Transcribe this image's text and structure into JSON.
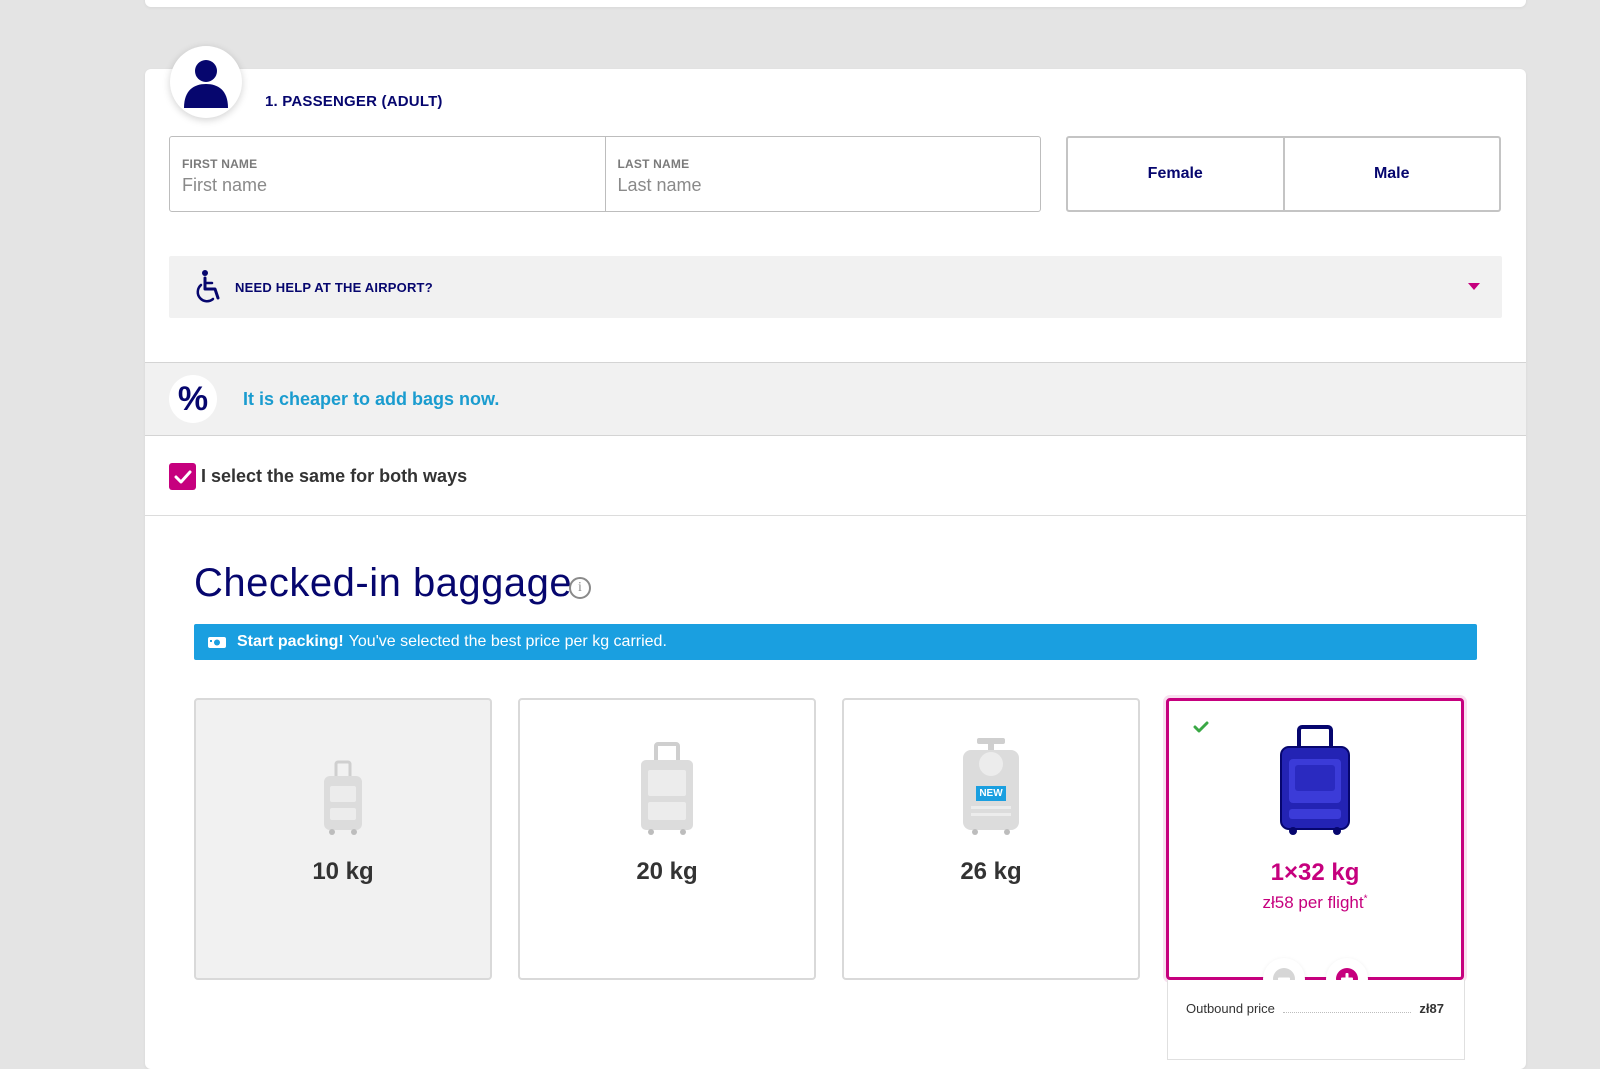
{
  "passenger": {
    "title": "1. PASSENGER (ADULT)",
    "first_name": {
      "label": "FIRST NAME",
      "placeholder": "First name",
      "value": ""
    },
    "last_name": {
      "label": "LAST NAME",
      "placeholder": "Last name",
      "value": ""
    },
    "gender_options": {
      "female": "Female",
      "male": "Male"
    },
    "help": {
      "label": "NEED HELP AT THE AIRPORT?"
    }
  },
  "promo": {
    "icon": "percent-icon",
    "symbol": "%",
    "text": "It is cheaper to add bags now."
  },
  "same_both_ways": {
    "label": "I select the same for both ways",
    "checked": true
  },
  "baggage": {
    "title": "Checked-in baggage",
    "info_symbol": "i",
    "banner": {
      "strong": "Start packing!",
      "text": "You've selected the best price per kg carried."
    },
    "options": [
      {
        "weight": "10 kg",
        "state": "disabled"
      },
      {
        "weight": "20 kg",
        "state": "available"
      },
      {
        "weight": "26 kg",
        "state": "available",
        "badge": "NEW"
      },
      {
        "weight": "1×32 kg",
        "state": "selected",
        "price": "zł58 per flight",
        "price_mark": "*"
      }
    ],
    "price_breakdown": [
      {
        "label": "Outbound price",
        "amount": "zł87"
      }
    ]
  },
  "colors": {
    "navy": "#06066e",
    "magenta": "#c6007e",
    "blue": "#1a9fe0",
    "promo_text": "#1a9ccf"
  }
}
